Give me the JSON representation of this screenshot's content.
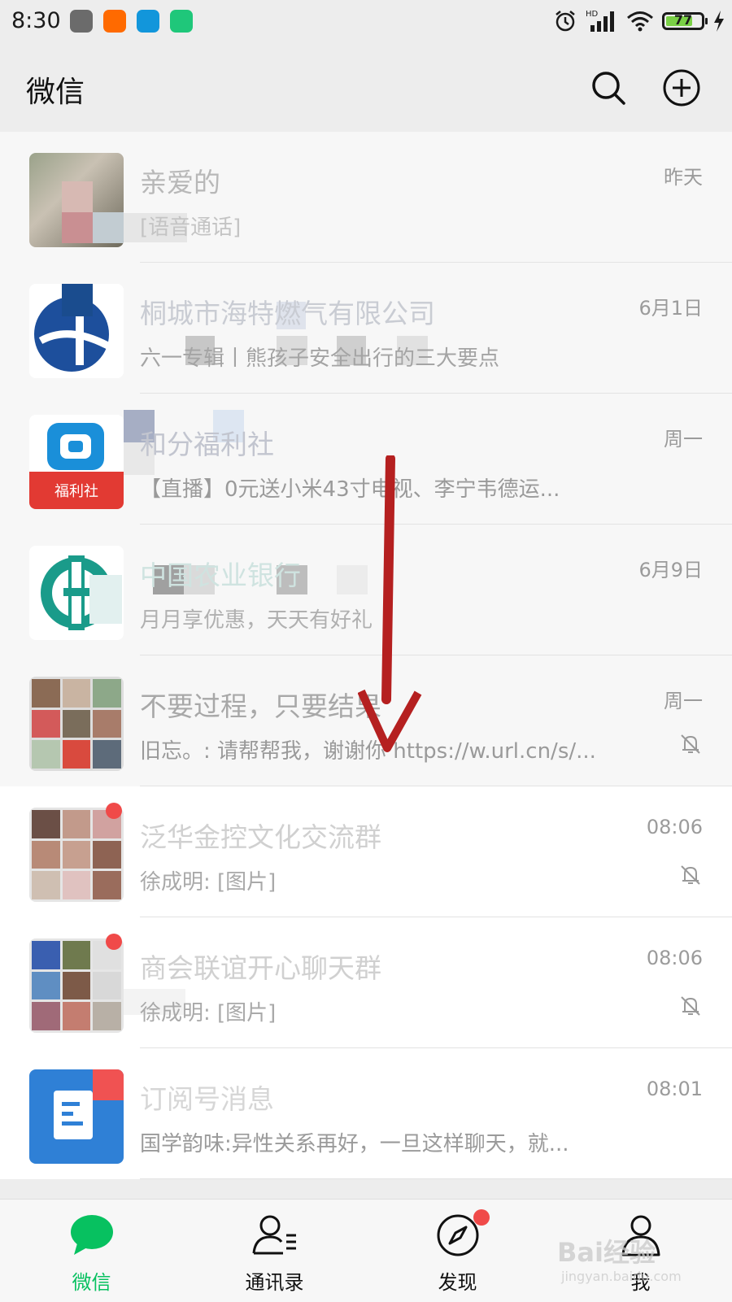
{
  "status_bar": {
    "time": "8:30",
    "network": "HD",
    "battery": "77",
    "battery_level": 0.77
  },
  "header": {
    "title": "微信",
    "search_icon": "search-icon",
    "add_icon": "plus-circle-icon"
  },
  "chats": [
    {
      "name": "亲爱的",
      "time": "昨天",
      "preview": "[语音通话]",
      "pinned": true,
      "muted": false,
      "unread_dot": false
    },
    {
      "name": "桐城市海特燃气有限公司",
      "time": "6月1日",
      "preview": "六一专辑丨熊孩子安全出行的三大要点",
      "pinned": true,
      "muted": false,
      "unread_dot": false
    },
    {
      "name": "和分福利社",
      "time": "周一",
      "preview": "【直播】0元送小米43寸电视、李宁韦德运...",
      "pinned": true,
      "muted": false,
      "unread_dot": false
    },
    {
      "name": "中国农业银行",
      "time": "6月9日",
      "preview": "月月享优惠，天天有好礼",
      "pinned": true,
      "muted": false,
      "unread_dot": false
    },
    {
      "name": "不要过程，只要结果",
      "time": "周一",
      "preview": "旧忘。: 请帮帮我，谢谢你 https://w.url.cn/s/...",
      "pinned": true,
      "muted": true,
      "unread_dot": false
    },
    {
      "name": "泛华金控文化交流群",
      "time": "08:06",
      "preview": "徐成明: [图片]",
      "pinned": false,
      "muted": true,
      "unread_dot": true
    },
    {
      "name": "商会联谊开心聊天群",
      "time": "08:06",
      "preview": "徐成明: [图片]",
      "pinned": false,
      "muted": true,
      "unread_dot": true
    },
    {
      "name": "订阅号消息",
      "time": "08:01",
      "preview": "国学韵味:异性关系再好，一旦这样聊天，就...",
      "pinned": false,
      "muted": false,
      "unread_dot": true
    }
  ],
  "tabs": [
    {
      "label": "微信",
      "icon": "chat-bubble-icon",
      "active": true
    },
    {
      "label": "通讯录",
      "icon": "contacts-icon",
      "active": false
    },
    {
      "label": "发现",
      "icon": "compass-icon",
      "active": false,
      "badge_dot": true
    },
    {
      "label": "我",
      "icon": "person-icon",
      "active": false
    }
  ],
  "watermark": {
    "text": "Bai经验",
    "sub": "jingyan.baidu.com"
  },
  "colors": {
    "accent": "#07c160",
    "badge": "#f04a49",
    "arrow": "#b52020"
  }
}
